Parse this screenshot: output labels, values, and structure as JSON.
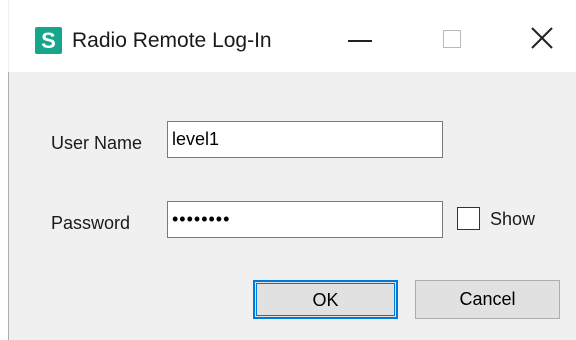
{
  "window": {
    "app_icon_letter": "S",
    "title": "Radio Remote Log-In",
    "controls": {
      "minimize": "minimize-icon",
      "maximize": "maximize-icon",
      "close": "close-icon"
    }
  },
  "form": {
    "username": {
      "label": "User Name",
      "value": "level1"
    },
    "password": {
      "label": "Password",
      "value": "••••••••"
    },
    "show_password": {
      "label": "Show",
      "checked": false
    }
  },
  "buttons": {
    "ok_label": "OK",
    "cancel_label": "Cancel"
  },
  "colors": {
    "app_icon": "#17a58c",
    "focus_border": "#0078d7"
  }
}
